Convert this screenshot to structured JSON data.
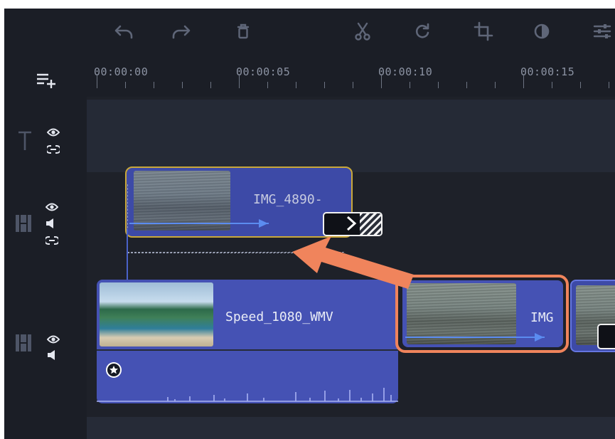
{
  "toolbar": {
    "buttons": [
      {
        "name": "undo-button",
        "icon": "undo-icon"
      },
      {
        "name": "redo-button",
        "icon": "redo-icon"
      },
      {
        "name": "delete-button",
        "icon": "trash-icon"
      },
      {
        "name": "cut-button",
        "icon": "scissors-icon"
      },
      {
        "name": "rotate-button",
        "icon": "rotate-icon"
      },
      {
        "name": "crop-button",
        "icon": "crop-icon"
      },
      {
        "name": "color-adjust-button",
        "icon": "contrast-icon"
      },
      {
        "name": "properties-button",
        "icon": "sliders-icon"
      }
    ]
  },
  "ruler": {
    "labels": [
      "00:00:00",
      "00:00:05",
      "00:00:10",
      "00:00:15"
    ]
  },
  "clips": {
    "overlay": {
      "label": "IMG_4890-"
    },
    "main": {
      "label": "Speed_1080_WMV"
    },
    "dragged": {
      "label": "IMG"
    }
  },
  "colors": {
    "background": "#1e2129",
    "clip": "#4552b4",
    "overlay_outline": "#c9a83a",
    "highlight": "#f0845c",
    "accent_arrow": "#5b8cf0"
  }
}
